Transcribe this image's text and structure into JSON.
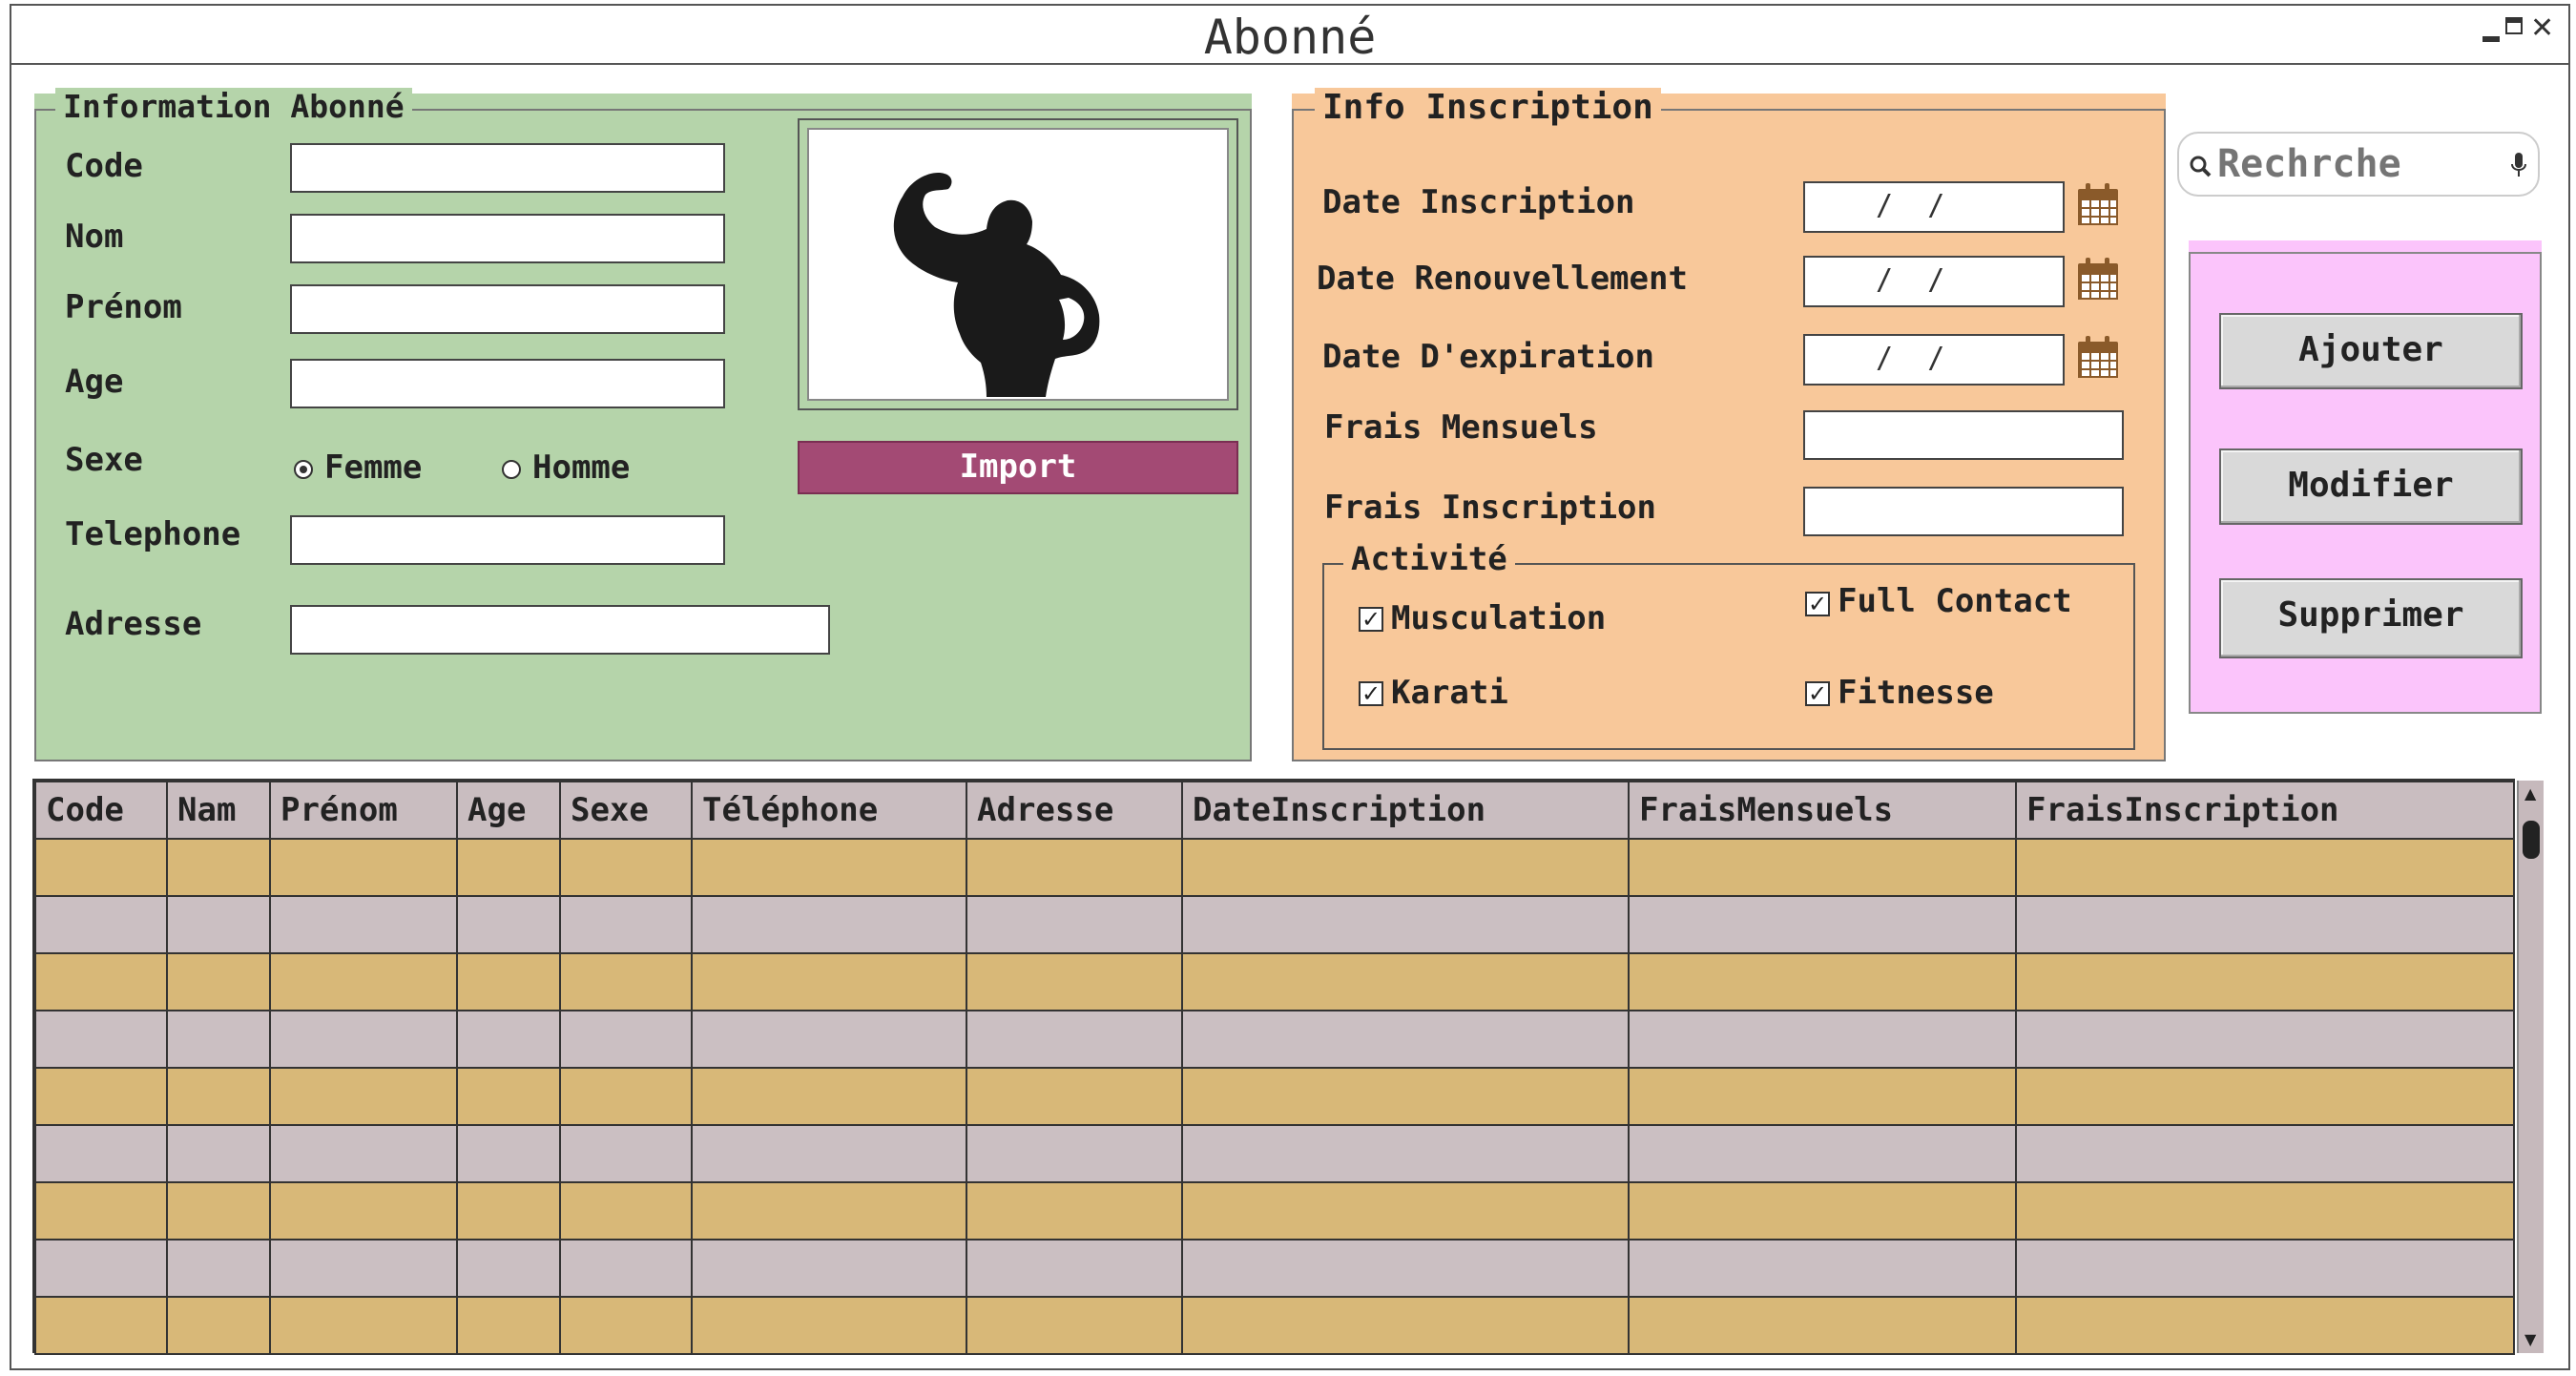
{
  "window": {
    "title": "Abonné"
  },
  "subscriber_panel": {
    "legend": "Information Abonné",
    "fields": [
      {
        "label": "Code",
        "value": ""
      },
      {
        "label": "Nom",
        "value": ""
      },
      {
        "label": "Prénom",
        "value": ""
      },
      {
        "label": "Age",
        "value": ""
      }
    ],
    "sex": {
      "label": "Sexe",
      "options": [
        "Femme",
        "Homme"
      ],
      "selected": "Femme"
    },
    "phone": {
      "label": "Telephone",
      "value": ""
    },
    "address": {
      "label": "Adresse",
      "value": ""
    },
    "import_button": "Import"
  },
  "inscription_panel": {
    "legend": "Info Inscription",
    "dates": [
      {
        "label": "Date Inscription",
        "value": " /  /"
      },
      {
        "label": "Date Renouvellement",
        "value": " /  /"
      },
      {
        "label": "Date D'expiration",
        "value": " /  /"
      }
    ],
    "frais_mensuels": {
      "label": "Frais Mensuels",
      "value": ""
    },
    "frais_inscription": {
      "label": "Frais Inscription",
      "value": ""
    },
    "activities": {
      "legend": "Activité",
      "items": [
        {
          "label": "Musculation",
          "checked": true
        },
        {
          "label": "Full Contact",
          "checked": true
        },
        {
          "label": "Karati",
          "checked": true
        },
        {
          "label": "Fitnesse",
          "checked": true
        }
      ]
    }
  },
  "search": {
    "placeholder": "Rechrche"
  },
  "actions": {
    "add": "Ajouter",
    "edit": "Modifier",
    "delete": "Supprimer"
  },
  "table": {
    "columns": [
      "Code",
      "Nam",
      "Prénom",
      "Age",
      "Sexe",
      "Téléphone",
      "Adresse",
      "DateInscription",
      "FraisMensuels",
      "FraisInscription"
    ],
    "rows": 9
  },
  "colors": {
    "subscriber_panel_bg": "#b5d4aa",
    "inscription_panel_bg": "#f8c89a",
    "actions_panel_bg": "#fbc4fb",
    "import_button_bg": "#a34a74",
    "row_odd": "#d8b878",
    "row_even": "#cbbfc2"
  },
  "icons": [
    "minimize-icon",
    "maximize-icon",
    "close-icon",
    "search-icon",
    "microphone-icon",
    "calendar-icon",
    "bodybuilder-silhouette"
  ]
}
